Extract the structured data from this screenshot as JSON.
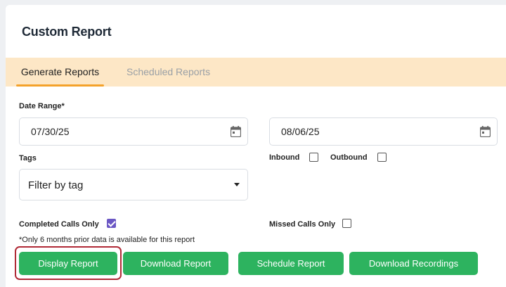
{
  "page": {
    "title": "Custom Report"
  },
  "tabs": [
    {
      "label": "Generate Reports",
      "active": true
    },
    {
      "label": "Scheduled Reports",
      "active": false
    }
  ],
  "form": {
    "date_range_label": "Date Range*",
    "start_date": "07/30/25",
    "end_date": "08/06/25",
    "tags_label": "Tags",
    "tags_value": "Filter by tag",
    "inbound_label": "Inbound",
    "inbound_checked": false,
    "outbound_label": "Outbound",
    "outbound_checked": false,
    "completed_label": "Completed Calls Only",
    "completed_checked": true,
    "missed_label": "Missed Calls Only",
    "missed_checked": false,
    "note": "*Only 6 months prior data is available for this report"
  },
  "buttons": {
    "display": "Display Report",
    "download": "Download Report",
    "schedule": "Schedule Report",
    "recordings": "Download Recordings"
  },
  "colors": {
    "accent_green": "#2db35f",
    "tab_bg": "#fde7c6",
    "tab_underline": "#f4a22b",
    "checkbox_checked": "#6b57c4",
    "highlight_border": "#b02a36"
  }
}
